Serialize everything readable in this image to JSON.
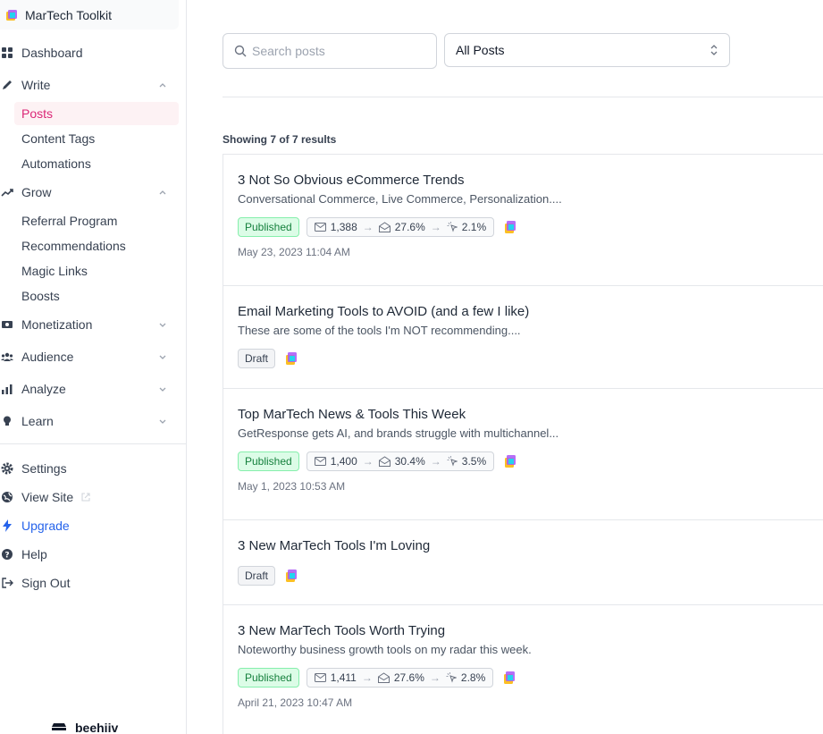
{
  "publication": {
    "name": "MarTech Toolkit",
    "logo_icon": "publication-logo-icon"
  },
  "sidebar": {
    "items": [
      {
        "label": "Dashboard",
        "icon": "grid-icon"
      },
      {
        "label": "Write",
        "icon": "pencil-icon",
        "expanded": true,
        "children": [
          "Posts",
          "Content Tags",
          "Automations"
        ]
      },
      {
        "label": "Grow",
        "icon": "trending-up-icon",
        "expanded": true,
        "children": [
          "Referral Program",
          "Recommendations",
          "Magic Links",
          "Boosts"
        ]
      },
      {
        "label": "Monetization",
        "icon": "money-icon",
        "expanded": false
      },
      {
        "label": "Audience",
        "icon": "users-icon",
        "expanded": false
      },
      {
        "label": "Analyze",
        "icon": "bar-chart-icon",
        "expanded": false
      },
      {
        "label": "Learn",
        "icon": "lightbulb-icon",
        "expanded": false
      }
    ],
    "active_item": "Posts",
    "bottom": [
      {
        "label": "Settings",
        "icon": "gear-icon"
      },
      {
        "label": "View Site",
        "icon": "globe-icon"
      },
      {
        "label": "Upgrade",
        "icon": "lightning-icon"
      },
      {
        "label": "Help",
        "icon": "help-icon"
      },
      {
        "label": "Sign Out",
        "icon": "sign-out-icon"
      }
    ],
    "footer_brand": "beehiiv"
  },
  "search": {
    "placeholder": "Search posts",
    "value": ""
  },
  "filter": {
    "selected": "All Posts"
  },
  "results_text": "Showing 7 of 7 results",
  "posts": [
    {
      "title": "3 Not So Obvious eCommerce Trends",
      "subtitle": "Conversational Commerce, Live Commerce, Personalization....",
      "status": "Published",
      "recipients": "1,388",
      "open_rate": "27.6%",
      "click_rate": "2.1%",
      "date": "May 23, 2023 11:04 AM"
    },
    {
      "title": "Email Marketing Tools to AVOID (and a few I like)",
      "subtitle": "These are some of the tools I'm NOT recommending....",
      "status": "Draft"
    },
    {
      "title": "Top MarTech News & Tools This Week",
      "subtitle": "GetResponse gets AI, and brands struggle with multichannel...",
      "status": "Published",
      "recipients": "1,400",
      "open_rate": "30.4%",
      "click_rate": "3.5%",
      "date": "May 1, 2023 10:53 AM"
    },
    {
      "title": "3 New MarTech Tools I'm Loving",
      "subtitle": "",
      "status": "Draft"
    },
    {
      "title": "3 New MarTech Tools Worth Trying",
      "subtitle": "Noteworthy business growth tools on my radar this week.",
      "status": "Published",
      "recipients": "1,411",
      "open_rate": "27.6%",
      "click_rate": "2.8%",
      "date": "April 21, 2023 10:47 AM"
    }
  ],
  "colors": {
    "accent_pink": "#db2777",
    "published_green": "#15803d",
    "upgrade_blue": "#2563eb"
  }
}
